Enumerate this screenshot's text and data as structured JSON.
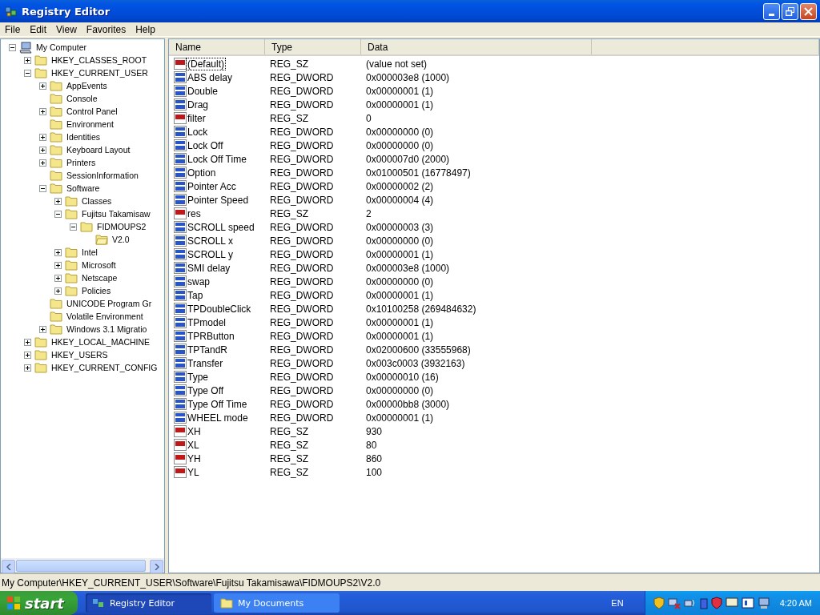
{
  "window": {
    "title": "Registry Editor"
  },
  "menu": [
    "File",
    "Edit",
    "View",
    "Favorites",
    "Help"
  ],
  "tree": [
    {
      "label": "My Computer",
      "kind": "computer",
      "expanded": true,
      "selected": false,
      "children": [
        {
          "label": "HKEY_CLASSES_ROOT",
          "kind": "folder",
          "expanded": false,
          "selected": false
        },
        {
          "label": "HKEY_CURRENT_USER",
          "kind": "folder",
          "expanded": true,
          "selected": false,
          "children": [
            {
              "label": "AppEvents",
              "kind": "folder",
              "expanded": false,
              "selected": false
            },
            {
              "label": "Console",
              "kind": "folder",
              "selected": false
            },
            {
              "label": "Control Panel",
              "kind": "folder",
              "expanded": false,
              "selected": false
            },
            {
              "label": "Environment",
              "kind": "folder",
              "selected": false
            },
            {
              "label": "Identities",
              "kind": "folder",
              "expanded": false,
              "selected": false
            },
            {
              "label": "Keyboard Layout",
              "kind": "folder",
              "expanded": false,
              "selected": false
            },
            {
              "label": "Printers",
              "kind": "folder",
              "expanded": false,
              "selected": false
            },
            {
              "label": "SessionInformation",
              "kind": "folder",
              "selected": false
            },
            {
              "label": "Software",
              "kind": "folder",
              "expanded": true,
              "selected": false,
              "children": [
                {
                  "label": "Classes",
                  "kind": "folder",
                  "expanded": false,
                  "selected": false
                },
                {
                  "label": "Fujitsu Takamisaw",
                  "kind": "folder",
                  "expanded": true,
                  "selected": false,
                  "children": [
                    {
                      "label": "FIDMOUPS2",
                      "kind": "folder",
                      "expanded": true,
                      "selected": false,
                      "children": [
                        {
                          "label": "V2.0",
                          "kind": "folder",
                          "selected": true
                        }
                      ]
                    }
                  ]
                },
                {
                  "label": "Intel",
                  "kind": "folder",
                  "expanded": false,
                  "selected": false
                },
                {
                  "label": "Microsoft",
                  "kind": "folder",
                  "expanded": false,
                  "selected": false
                },
                {
                  "label": "Netscape",
                  "kind": "folder",
                  "expanded": false,
                  "selected": false
                },
                {
                  "label": "Policies",
                  "kind": "folder",
                  "expanded": false,
                  "selected": false
                }
              ]
            },
            {
              "label": "UNICODE Program Gr",
              "kind": "folder",
              "selected": false
            },
            {
              "label": "Volatile Environment",
              "kind": "folder",
              "selected": false
            },
            {
              "label": "Windows 3.1 Migratio",
              "kind": "folder",
              "expanded": false,
              "selected": false
            }
          ]
        },
        {
          "label": "HKEY_LOCAL_MACHINE",
          "kind": "folder",
          "expanded": false,
          "selected": false
        },
        {
          "label": "HKEY_USERS",
          "kind": "folder",
          "expanded": false,
          "selected": false
        },
        {
          "label": "HKEY_CURRENT_CONFIG",
          "kind": "folder",
          "expanded": false,
          "selected": false
        }
      ]
    }
  ],
  "table": {
    "columns": [
      "Name",
      "Type",
      "Data"
    ],
    "rows": [
      {
        "kind": "sz",
        "name": "(Default)",
        "type": "REG_SZ",
        "data": "(value not set)",
        "focused": true
      },
      {
        "kind": "dword",
        "name": "ABS delay",
        "type": "REG_DWORD",
        "data": "0x000003e8 (1000)",
        "focused": false
      },
      {
        "kind": "dword",
        "name": "Double",
        "type": "REG_DWORD",
        "data": "0x00000001 (1)",
        "focused": false
      },
      {
        "kind": "dword",
        "name": "Drag",
        "type": "REG_DWORD",
        "data": "0x00000001 (1)",
        "focused": false
      },
      {
        "kind": "sz",
        "name": "filter",
        "type": "REG_SZ",
        "data": "0",
        "focused": false
      },
      {
        "kind": "dword",
        "name": "Lock",
        "type": "REG_DWORD",
        "data": "0x00000000 (0)",
        "focused": false
      },
      {
        "kind": "dword",
        "name": "Lock Off",
        "type": "REG_DWORD",
        "data": "0x00000000 (0)",
        "focused": false
      },
      {
        "kind": "dword",
        "name": "Lock Off Time",
        "type": "REG_DWORD",
        "data": "0x000007d0 (2000)",
        "focused": false
      },
      {
        "kind": "dword",
        "name": "Option",
        "type": "REG_DWORD",
        "data": "0x01000501 (16778497)",
        "focused": false
      },
      {
        "kind": "dword",
        "name": "Pointer Acc",
        "type": "REG_DWORD",
        "data": "0x00000002 (2)",
        "focused": false
      },
      {
        "kind": "dword",
        "name": "Pointer Speed",
        "type": "REG_DWORD",
        "data": "0x00000004 (4)",
        "focused": false
      },
      {
        "kind": "sz",
        "name": "res",
        "type": "REG_SZ",
        "data": "2",
        "focused": false
      },
      {
        "kind": "dword",
        "name": "SCROLL speed",
        "type": "REG_DWORD",
        "data": "0x00000003 (3)",
        "focused": false
      },
      {
        "kind": "dword",
        "name": "SCROLL x",
        "type": "REG_DWORD",
        "data": "0x00000000 (0)",
        "focused": false
      },
      {
        "kind": "dword",
        "name": "SCROLL y",
        "type": "REG_DWORD",
        "data": "0x00000001 (1)",
        "focused": false
      },
      {
        "kind": "dword",
        "name": "SMI delay",
        "type": "REG_DWORD",
        "data": "0x000003e8 (1000)",
        "focused": false
      },
      {
        "kind": "dword",
        "name": "swap",
        "type": "REG_DWORD",
        "data": "0x00000000 (0)",
        "focused": false
      },
      {
        "kind": "dword",
        "name": "Tap",
        "type": "REG_DWORD",
        "data": "0x00000001 (1)",
        "focused": false
      },
      {
        "kind": "dword",
        "name": "TPDoubleClick",
        "type": "REG_DWORD",
        "data": "0x10100258 (269484632)",
        "focused": false
      },
      {
        "kind": "dword",
        "name": "TPmodel",
        "type": "REG_DWORD",
        "data": "0x00000001 (1)",
        "focused": false
      },
      {
        "kind": "dword",
        "name": "TPRButton",
        "type": "REG_DWORD",
        "data": "0x00000001 (1)",
        "focused": false
      },
      {
        "kind": "dword",
        "name": "TPTandR",
        "type": "REG_DWORD",
        "data": "0x02000600 (33555968)",
        "focused": false
      },
      {
        "kind": "dword",
        "name": "Transfer",
        "type": "REG_DWORD",
        "data": "0x003c0003 (3932163)",
        "focused": false
      },
      {
        "kind": "dword",
        "name": "Type",
        "type": "REG_DWORD",
        "data": "0x00000010 (16)",
        "focused": false
      },
      {
        "kind": "dword",
        "name": "Type Off",
        "type": "REG_DWORD",
        "data": "0x00000000 (0)",
        "focused": false
      },
      {
        "kind": "dword",
        "name": "Type Off Time",
        "type": "REG_DWORD",
        "data": "0x00000bb8 (3000)",
        "focused": false
      },
      {
        "kind": "dword",
        "name": "WHEEL mode",
        "type": "REG_DWORD",
        "data": "0x00000001 (1)",
        "focused": false
      },
      {
        "kind": "sz",
        "name": "XH",
        "type": "REG_SZ",
        "data": "930",
        "focused": false
      },
      {
        "kind": "sz",
        "name": "XL",
        "type": "REG_SZ",
        "data": "80",
        "focused": false
      },
      {
        "kind": "sz",
        "name": "YH",
        "type": "REG_SZ",
        "data": "860",
        "focused": false
      },
      {
        "kind": "sz",
        "name": "YL",
        "type": "REG_SZ",
        "data": "100",
        "focused": false
      }
    ]
  },
  "status_bar": "My Computer\\HKEY_CURRENT_USER\\Software\\Fujitsu Takamisawa\\FIDMOUPS2\\V2.0",
  "taskbar": {
    "start": "start",
    "tasks": [
      {
        "label": "Registry Editor",
        "selected": true,
        "kind": "regedit"
      },
      {
        "label": "My Documents",
        "selected": false,
        "kind": "folder"
      }
    ],
    "language": "EN",
    "clock": "4:20 AM"
  }
}
